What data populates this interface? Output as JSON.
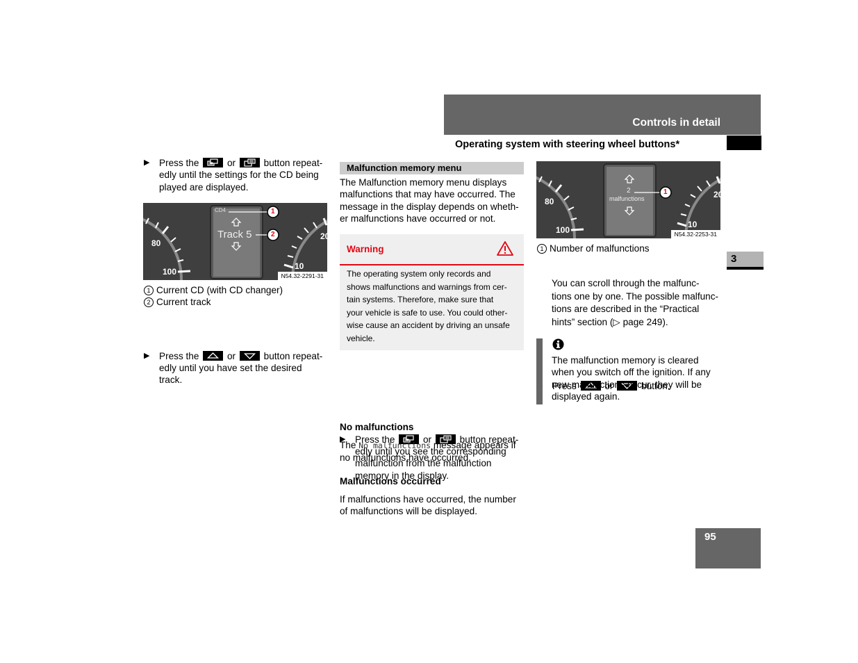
{
  "header": {
    "chapter_title": "Controls in detail",
    "section_title": "Operating system with steering wheel buttons*",
    "chapter_number": "3",
    "page_number": "95"
  },
  "colors": {
    "header_gray": "#666666",
    "warning_red": "#e30613",
    "section_bar_gray": "#cccccc",
    "warning_bg": "#efefef"
  },
  "left_column": {
    "step1": {
      "prefix": "Press the",
      "icon1": "display-prev-button-icon",
      "or": "or",
      "icon2": "display-next-button-icon",
      "suffix": "button repeat-",
      "line2": "edly until the settings for the CD being",
      "line3": "played are displayed."
    },
    "figure": {
      "label": "N54.32-2291-31",
      "display_top": "CD4",
      "display_main": "Track 5",
      "callout1": "1",
      "callout2": "2",
      "gauge_left_ticks": [
        "80",
        "100"
      ],
      "gauge_right_ticks": [
        "20",
        "10"
      ]
    },
    "legend": [
      {
        "num": "1",
        "text": "Current CD (with CD changer)"
      },
      {
        "num": "2",
        "text": "Current track"
      }
    ],
    "step2": {
      "prefix": "Press the",
      "icon1": "up-button-icon",
      "or": "or",
      "icon2": "down-button-icon",
      "suffix": "button repeat-",
      "line2": "edly until you have set the desired",
      "line3": "track."
    }
  },
  "middle_column": {
    "section_heading": "Malfunction memory menu",
    "intro": [
      "The Malfunction memory menu displays",
      "malfunctions that may have occurred. The",
      "message in the display depends on wheth-",
      "er malfunctions have occurred or not."
    ],
    "warning": {
      "title": "Warning",
      "icon": "warning-triangle-icon",
      "lines": [
        "The operating system only records and",
        "shows malfunctions and warnings from cer-",
        "tain systems. Therefore, make sure that",
        "your vehicle is safe to use. You could other-",
        "wise cause an accident by driving an unsafe",
        "vehicle."
      ]
    },
    "step": {
      "prefix": "Press the",
      "or": "or",
      "suffix": "button repeat-",
      "line2": "edly until you see the corresponding",
      "line3": "malfunction from the malfunction",
      "line4": "memory in the display."
    },
    "no_malfunctions": {
      "heading": "No malfunctions",
      "pre": "The",
      "code": "No malfunctions",
      "post": "message appears if",
      "line2": "no malfunctions have occurred."
    },
    "malfunctions_occurred": {
      "heading": "Malfunctions occurred",
      "line1": "If malfunctions have occurred, the number",
      "line2": "of malfunctions will be displayed."
    }
  },
  "right_column": {
    "figure": {
      "label": "N54.32-2253-31",
      "display_count": "2",
      "display_text": "malfunctions",
      "callout1": "1",
      "gauge_left_ticks": [
        "80",
        "100"
      ],
      "gauge_right_ticks": [
        "20",
        "10"
      ]
    },
    "legend": [
      {
        "num": "1",
        "text": "Number of malfunctions"
      }
    ],
    "step": {
      "prefix": "Press",
      "or": "or",
      "suffix": "button."
    },
    "scroll_text": [
      "You can scroll through the malfunc-",
      "tions one by one. The possible malfunc-",
      "tions are described in the “Practical",
      "hints” section (▷ page 249)."
    ],
    "note": {
      "icon": "info-icon",
      "lines": [
        "The malfunction memory is cleared",
        "when you switch off the ignition. If any",
        "new malfunctions occur, they will be",
        "displayed again."
      ]
    }
  }
}
